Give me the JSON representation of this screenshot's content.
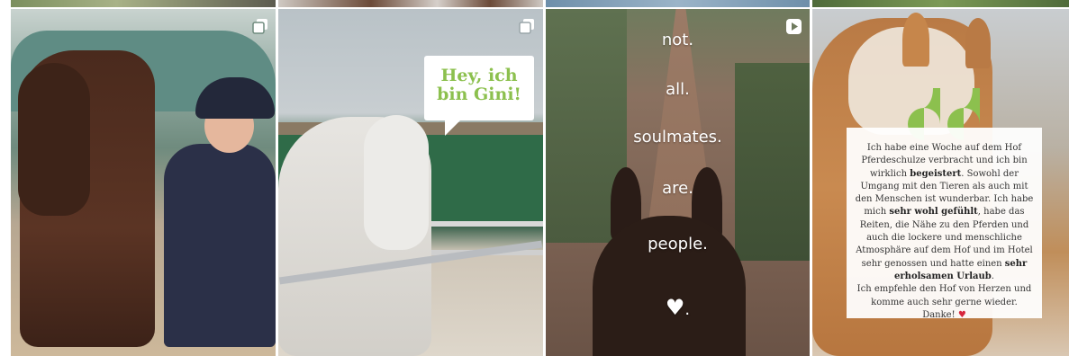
{
  "colors": {
    "bubble_text": "#8cc04e",
    "quote_mark": "#8cc04e",
    "heart": "#d7263d"
  },
  "icons": {
    "tile1": "multiple-images-icon",
    "tile2": "multiple-images-icon",
    "tile3": "reel-play-icon"
  },
  "tile2": {
    "bubble_line1": "Hey, ich",
    "bubble_line2": "bin Gini!"
  },
  "tile3": {
    "words": [
      "not.",
      "all.",
      "soulmates.",
      "are.",
      "people."
    ],
    "heart_suffix": "."
  },
  "tile4": {
    "quote": {
      "p1": "Ich habe eine Woche auf dem Hof Pferdeschulze verbracht und ich bin wirklich ",
      "b1": "begeistert",
      "p2": ". Sowohl der Umgang mit den Tieren als auch mit den Menschen ist wunderbar. Ich habe mich ",
      "b2": "sehr wohl gefühlt",
      "p3": ", habe das Reiten, die Nähe zu den Pferden und auch die lockere und menschliche Atmosphäre auf dem Hof und im Hotel sehr genossen und hatte einen ",
      "b3": "sehr erholsamen Urlaub",
      "p4": ".",
      "p5": "Ich empfehle den Hof von Herzen und komme auch sehr gerne wieder.",
      "p6": "Danke!"
    }
  }
}
